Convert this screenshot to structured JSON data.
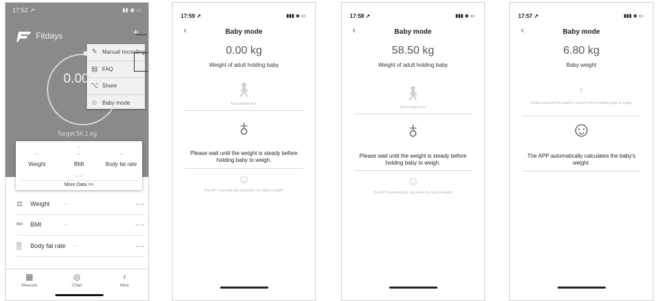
{
  "screen1": {
    "status_time": "17:52 ↗",
    "status_icons": "▮▮ ◉ ▭",
    "app_name": "Fitdays",
    "plus_icon": "+",
    "gauge_value": "0.00",
    "menu": [
      {
        "icon": "edit-icon",
        "glyph": "✎",
        "label": "Manual recording"
      },
      {
        "icon": "book-icon",
        "glyph": "▤",
        "label": "FAQ"
      },
      {
        "icon": "share-icon",
        "glyph": "⌥",
        "label": "Share"
      },
      {
        "icon": "baby-icon",
        "glyph": "☺",
        "label": "Baby mode"
      }
    ],
    "target": "Target:56.1 kg",
    "card": {
      "top_dash": "--",
      "cols": [
        {
          "value": "--",
          "label": "Weight"
        },
        {
          "value": "--",
          "label": "BMI"
        },
        {
          "value": "--",
          "label": "Body fat rate"
        }
      ],
      "mid_dash": "-- --",
      "more": "More Data >>"
    },
    "rows": [
      {
        "icon": "scale-icon",
        "glyph": "⚖",
        "label": "Weight",
        "mid": "--",
        "value": "-- --"
      },
      {
        "icon": "bmi-icon",
        "glyph": "BMI",
        "label": "BMI",
        "mid": "--",
        "value": "-- --"
      },
      {
        "icon": "fat-icon",
        "glyph": "▒",
        "label": "Body fat rate",
        "mid": "--",
        "value": "-- --"
      }
    ],
    "tabs": [
      {
        "icon": "measure-icon",
        "glyph": "▦",
        "label": "Measure"
      },
      {
        "icon": "chart-icon",
        "glyph": "◎",
        "label": "Chart"
      },
      {
        "icon": "person-icon",
        "glyph": "♀",
        "label": "Mine"
      }
    ]
  },
  "screen2": {
    "status_time": "17:59 ↗",
    "status_icons": "▮▮▮ ◉ ▭",
    "title": "Baby mode",
    "weight": "0.00 kg",
    "desc": "Weight of adult holding baby",
    "hint_adult": "Adult weighs first.",
    "hint_wait": "Please wait until the weight is steady before holding baby to weigh.",
    "hint_app": "The APP automatically calculates the baby's weight."
  },
  "screen3": {
    "status_time": "17:58 ↗",
    "status_icons": "▮▮▮ ◉ ▭",
    "title": "Baby mode",
    "weight": "58.50 kg",
    "desc": "Weight of adult holding baby",
    "hint_adult": "Adult weighs first.",
    "hint_wait": "Please wait until the weight is steady before holding baby to weigh.",
    "hint_app": "The APP automatically calculates the baby's weight."
  },
  "screen4": {
    "status_time": "17:57 ↗",
    "status_icons": "▮▮▮ ◉ ▭",
    "title": "Baby mode",
    "weight": "6.80 kg",
    "desc": "Baby weight",
    "hint_wait": "Please wait until the weight is steady before holding baby to weigh.",
    "hint_app": "The APP automatically calculates the baby's weight."
  },
  "colors": {
    "header_gray": "#8a8a8a",
    "menu_bg": "#f1f1f1",
    "text_dark": "#222222"
  }
}
